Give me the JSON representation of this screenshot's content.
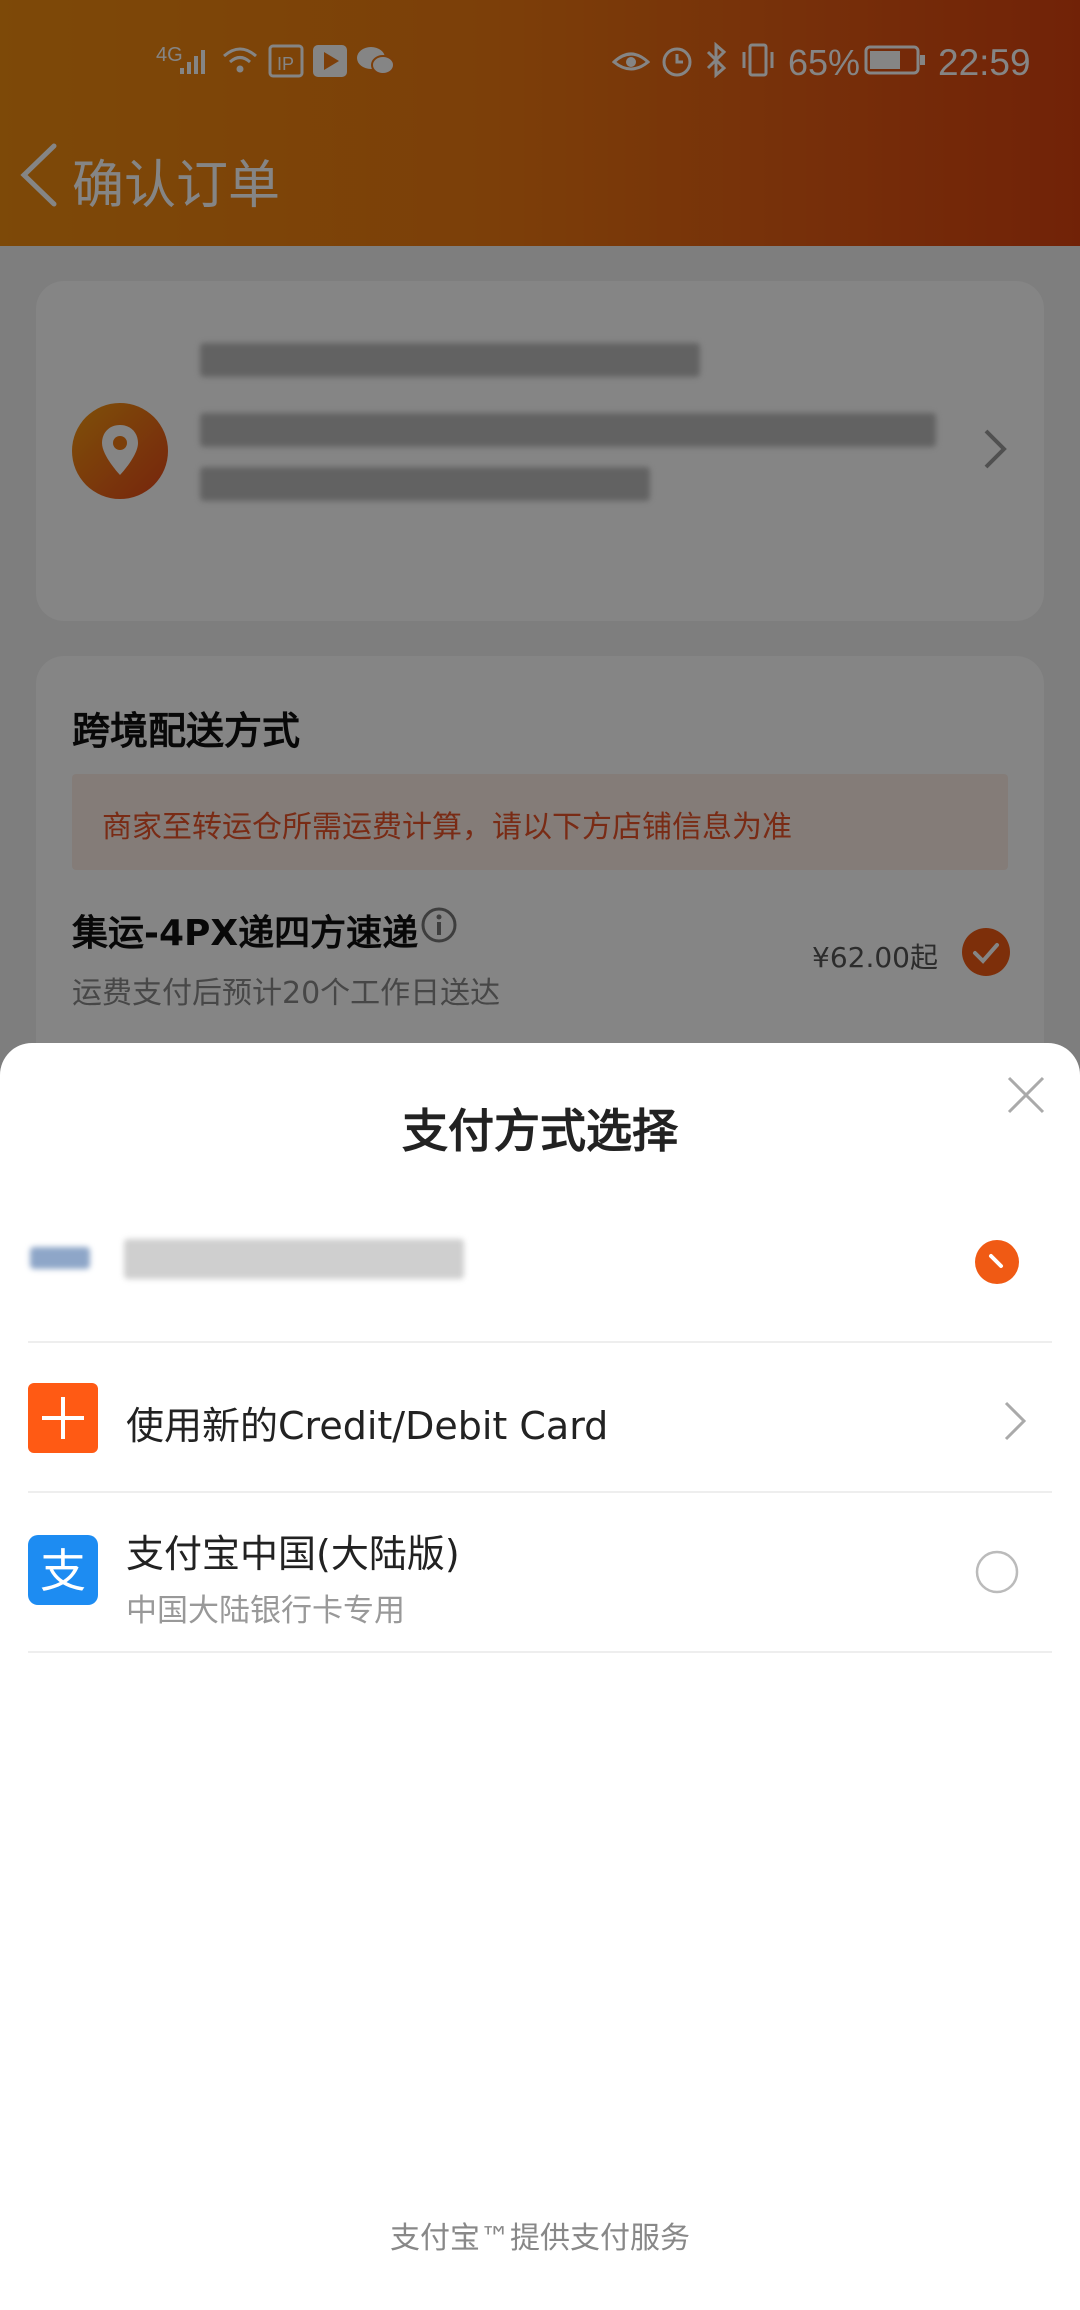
{
  "status_bar": {
    "network": "4G",
    "battery_percent": "65%",
    "time": "22:59"
  },
  "header": {
    "title": "确认订单"
  },
  "shipping": {
    "title": "跨境配送方式",
    "notice": "商家至转运仓所需运费计算，请以下方店铺信息为准",
    "method_name": "集运-4PX递四方速递",
    "method_desc": "运费支付后预计20个工作日送达",
    "price": "¥62.00起"
  },
  "payment_sheet": {
    "title": "支付方式选择",
    "options": [
      {
        "label": "使用新的Credit/Debit Card"
      },
      {
        "label": "支付宝中国(大陆版)",
        "sublabel": "中国大陆银行卡专用"
      }
    ],
    "footer": "支付宝™提供支付服务"
  },
  "colors": {
    "accent": "#f05a14",
    "alipay_blue": "#1d8cf2"
  }
}
